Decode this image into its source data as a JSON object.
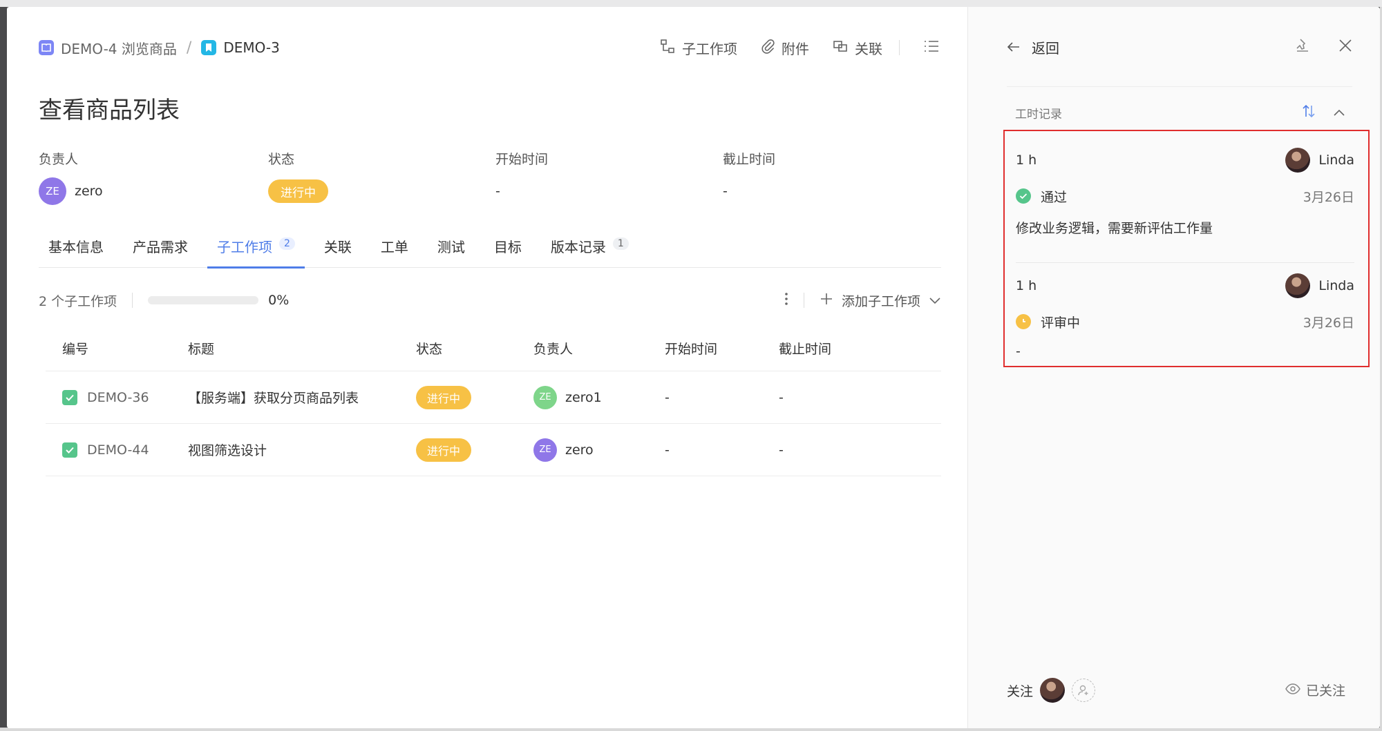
{
  "breadcrumb": {
    "project": "DEMO-4 浏览商品",
    "separator": "/",
    "current": "DEMO-3"
  },
  "toolbar": {
    "subitems": "子工作项",
    "attachment": "附件",
    "relation": "关联"
  },
  "title": "查看商品列表",
  "fields": {
    "assignee_label": "负责人",
    "assignee_initials": "ZE",
    "assignee_name": "zero",
    "status_label": "状态",
    "status_value": "进行中",
    "start_label": "开始时间",
    "start_value": "-",
    "due_label": "截止时间",
    "due_value": "-"
  },
  "tabs": [
    {
      "label": "基本信息",
      "count": ""
    },
    {
      "label": "产品需求",
      "count": ""
    },
    {
      "label": "子工作项",
      "count": "2"
    },
    {
      "label": "关联",
      "count": ""
    },
    {
      "label": "工单",
      "count": ""
    },
    {
      "label": "测试",
      "count": ""
    },
    {
      "label": "目标",
      "count": ""
    },
    {
      "label": "版本记录",
      "count": "1"
    }
  ],
  "subitems": {
    "summary": "2 个子工作项",
    "progress_text": "0%",
    "progress": 0,
    "add_label": "添加子工作项"
  },
  "table": {
    "headers": [
      "编号",
      "标题",
      "状态",
      "负责人",
      "开始时间",
      "截止时间"
    ],
    "rows": [
      {
        "id": "DEMO-36",
        "title": "【服务端】获取分页商品列表",
        "status": "进行中",
        "initials": "ZE",
        "owner": "zero1",
        "start": "-",
        "due": "-"
      },
      {
        "id": "DEMO-44",
        "title": "视图筛选设计",
        "status": "进行中",
        "initials": "ZE",
        "owner": "zero",
        "start": "-",
        "due": "-"
      }
    ]
  },
  "side": {
    "back": "返回",
    "worklog_title": "工时记录",
    "records": [
      {
        "hours": "1 h",
        "user": "Linda",
        "status": "通过",
        "date": "3月26日",
        "note": "修改业务逻辑，需要新评估工作量"
      },
      {
        "hours": "1 h",
        "user": "Linda",
        "status": "评审中",
        "date": "3月26日",
        "note": "-"
      }
    ],
    "follow_label": "关注",
    "followed_label": "已关注"
  },
  "colors": {
    "accent": "#4f7de8",
    "status_in_progress": "#f7c145",
    "status_passed": "#56c58b",
    "highlight_border": "#e02d2d",
    "avatar_zero": "#8f77e8",
    "avatar_zero1": "#7ed58a"
  }
}
